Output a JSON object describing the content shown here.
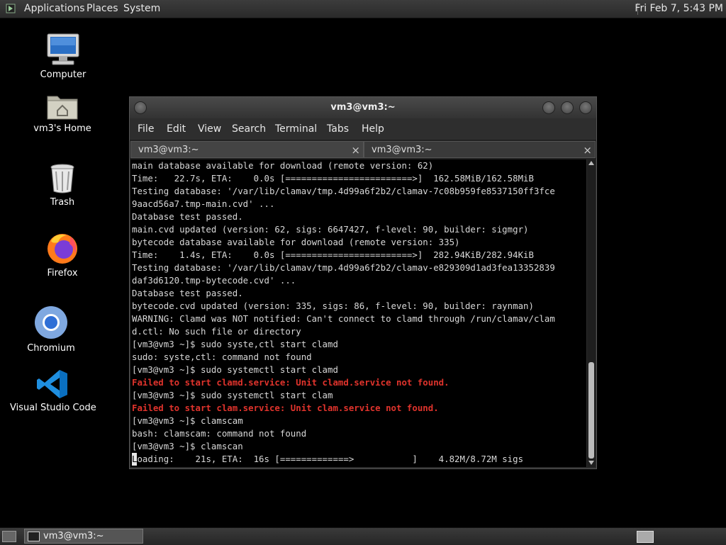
{
  "top_panel": {
    "menus": [
      "Applications",
      "Places",
      "System"
    ],
    "clock": "Fri Feb  7,  5:43 PM"
  },
  "desktop_icons": [
    {
      "label": "Computer",
      "icon": "computer-icon"
    },
    {
      "label": "vm3's Home",
      "icon": "home-folder-icon"
    },
    {
      "label": "Trash",
      "icon": "trash-icon"
    },
    {
      "label": "Firefox",
      "icon": "firefox-icon"
    },
    {
      "label": "Chromium",
      "icon": "chromium-icon"
    },
    {
      "label": "Visual Studio Code",
      "icon": "vscode-icon"
    }
  ],
  "window": {
    "title": "vm3@vm3:~",
    "menus": [
      "File",
      "Edit",
      "View",
      "Search",
      "Terminal",
      "Tabs",
      "Help"
    ],
    "tabs": [
      {
        "label": "vm3@vm3:~",
        "active": true
      },
      {
        "label": "vm3@vm3:~",
        "active": false
      }
    ],
    "close_glyph": "×"
  },
  "terminal": {
    "lines": [
      {
        "text": "main database available for download (remote version: 62)"
      },
      {
        "text": "Time:   22.7s, ETA:    0.0s [========================>]  162.58MiB/162.58MiB"
      },
      {
        "text": "Testing database: '/var/lib/clamav/tmp.4d99a6f2b2/clamav-7c08b959fe8537150ff3fce"
      },
      {
        "text": "9aacd56a7.tmp-main.cvd' ..."
      },
      {
        "text": "Database test passed."
      },
      {
        "text": "main.cvd updated (version: 62, sigs: 6647427, f-level: 90, builder: sigmgr)"
      },
      {
        "text": "bytecode database available for download (remote version: 335)"
      },
      {
        "text": "Time:    1.4s, ETA:    0.0s [========================>]  282.94KiB/282.94KiB"
      },
      {
        "text": "Testing database: '/var/lib/clamav/tmp.4d99a6f2b2/clamav-e829309d1ad3fea13352839"
      },
      {
        "text": "daf3d6120.tmp-bytecode.cvd' ..."
      },
      {
        "text": "Database test passed."
      },
      {
        "text": "bytecode.cvd updated (version: 335, sigs: 86, f-level: 90, builder: raynman)"
      },
      {
        "text": "WARNING: Clamd was NOT notified: Can't connect to clamd through /run/clamav/clam"
      },
      {
        "text": "d.ctl: No such file or directory"
      },
      {
        "text": "[vm3@vm3 ~]$ sudo syste,ctl start clamd"
      },
      {
        "text": "sudo: syste,ctl: command not found"
      },
      {
        "text": "[vm3@vm3 ~]$ sudo systemctl start clamd"
      },
      {
        "text": "Failed to start clamd.service: Unit clamd.service not found.",
        "error": true
      },
      {
        "text": "[vm3@vm3 ~]$ sudo systemctl start clam"
      },
      {
        "text": "Failed to start clam.service: Unit clam.service not found.",
        "error": true
      },
      {
        "text": "[vm3@vm3 ~]$ clamscam"
      },
      {
        "text": "bash: clamscam: command not found"
      },
      {
        "text": "[vm3@vm3 ~]$ clamscan"
      }
    ],
    "last_line": "oading:    21s, ETA:  16s [=============>           ]    4.82M/8.72M sigs",
    "last_line_first_char": "L",
    "error_color": "#e0332c"
  },
  "bottom_panel": {
    "task_label": "vm3@vm3:~"
  }
}
